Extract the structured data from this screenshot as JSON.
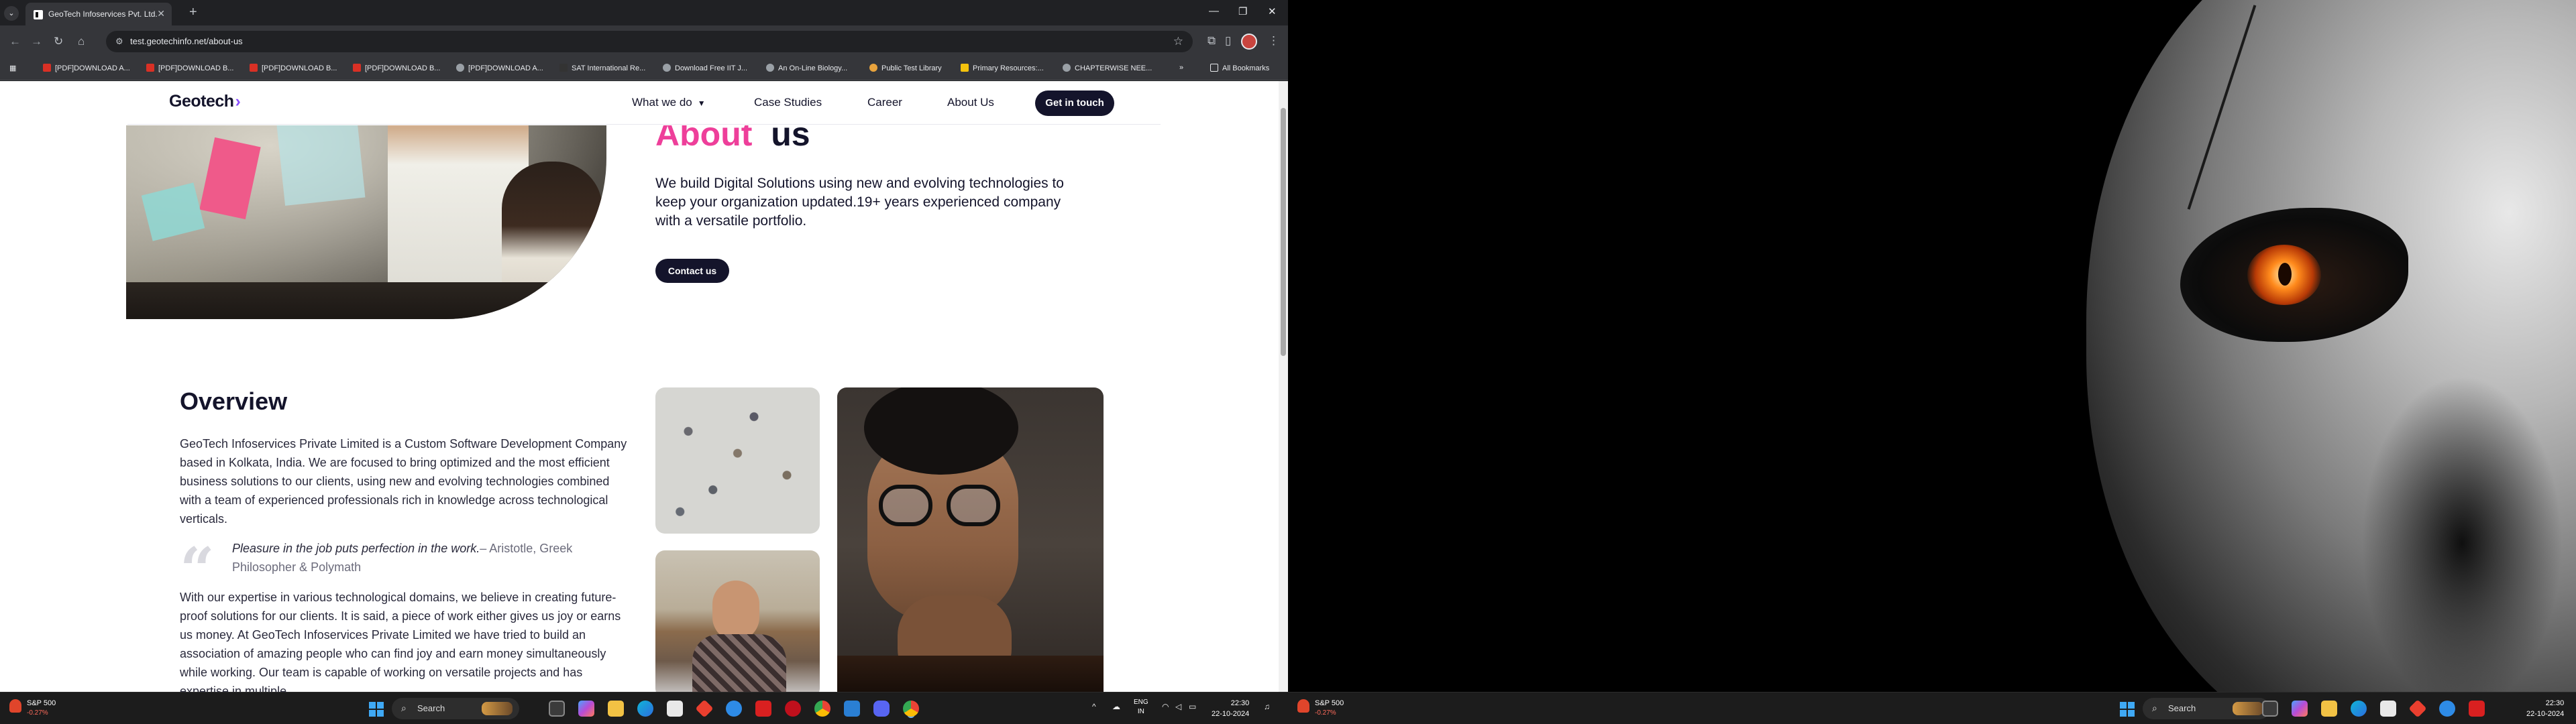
{
  "browser": {
    "tab_title": "GeoTech Infoservices Pvt. Ltd.",
    "tab_close": "✕",
    "new_tab": "+",
    "window_minimize": "—",
    "window_restore": "❐",
    "window_close": "✕",
    "url": "test.geotechinfo.net/about-us",
    "all_bookmarks": "All Bookmarks",
    "bookmarks": [
      {
        "label": "[PDF]DOWNLOAD A...",
        "color": "#d93025"
      },
      {
        "label": "[PDF]DOWNLOAD B...",
        "color": "#d93025"
      },
      {
        "label": "[PDF]DOWNLOAD B...",
        "color": "#d93025"
      },
      {
        "label": "[PDF]DOWNLOAD B...",
        "color": "#d93025"
      },
      {
        "label": "[PDF]DOWNLOAD A...",
        "color": "#9aa0a6"
      },
      {
        "label": "SAT International Re...",
        "color": "#333333"
      },
      {
        "label": "Download Free IIT J...",
        "color": "#9aa0a6"
      },
      {
        "label": "An On-Line Biology...",
        "color": "#9aa0a6"
      },
      {
        "label": "Public Test Library",
        "color": "#e8a33d"
      },
      {
        "label": "Primary Resources:...",
        "color": "#f4c20d"
      },
      {
        "label": "CHAPTERWISE NEE...",
        "color": "#9aa0a6"
      }
    ]
  },
  "site": {
    "logo": "Geotech",
    "logo_chevron": "›",
    "nav": {
      "what_we_do": "What we do",
      "case_studies": "Case Studies",
      "career": "Career",
      "about_us": "About Us",
      "cta": "Get in touch"
    },
    "hero": {
      "title_pink": "About",
      "title_dark": "us",
      "text": "We build Digital Solutions using new and evolving technologies to keep your organization updated.19+ years experienced company with a versatile portfolio.",
      "contact_button": "Contact us"
    },
    "overview": {
      "title": "Overview",
      "paragraph1": "GeoTech Infoservices Private Limited is a Custom Software Development Company based in Kolkata, India. We are focused to bring optimized and the most efficient business solutions to our clients, using new and evolving technologies combined with a team of experienced professionals rich in knowledge across technological verticals.",
      "quote_mark": "“",
      "quote_text": "Pleasure in the job puts perfection in the work.",
      "quote_author": "– Aristotle, Greek Philosopher & Polymath",
      "paragraph2": "With our expertise in various technological domains, we believe in creating future-proof solutions for our clients. It is said, a piece of work either gives us joy or earns us money. At GeoTech Infoservices Private Limited we have tried to build an association of amazing people who can find joy and earn money simultaneously while working. Our team is capable of working on versatile projects and has expertise in multiple"
    }
  },
  "taskbar": {
    "stock_name": "S&P 500",
    "stock_change": "-0.27%",
    "search_label": "Search",
    "lang_1": "ENG",
    "lang_2": "IN",
    "time": "22:30",
    "date": "22-10-2024",
    "tray_chevron": "^"
  },
  "colors": {
    "accent_pink": "#ee3f9a",
    "navy": "#14142b"
  }
}
